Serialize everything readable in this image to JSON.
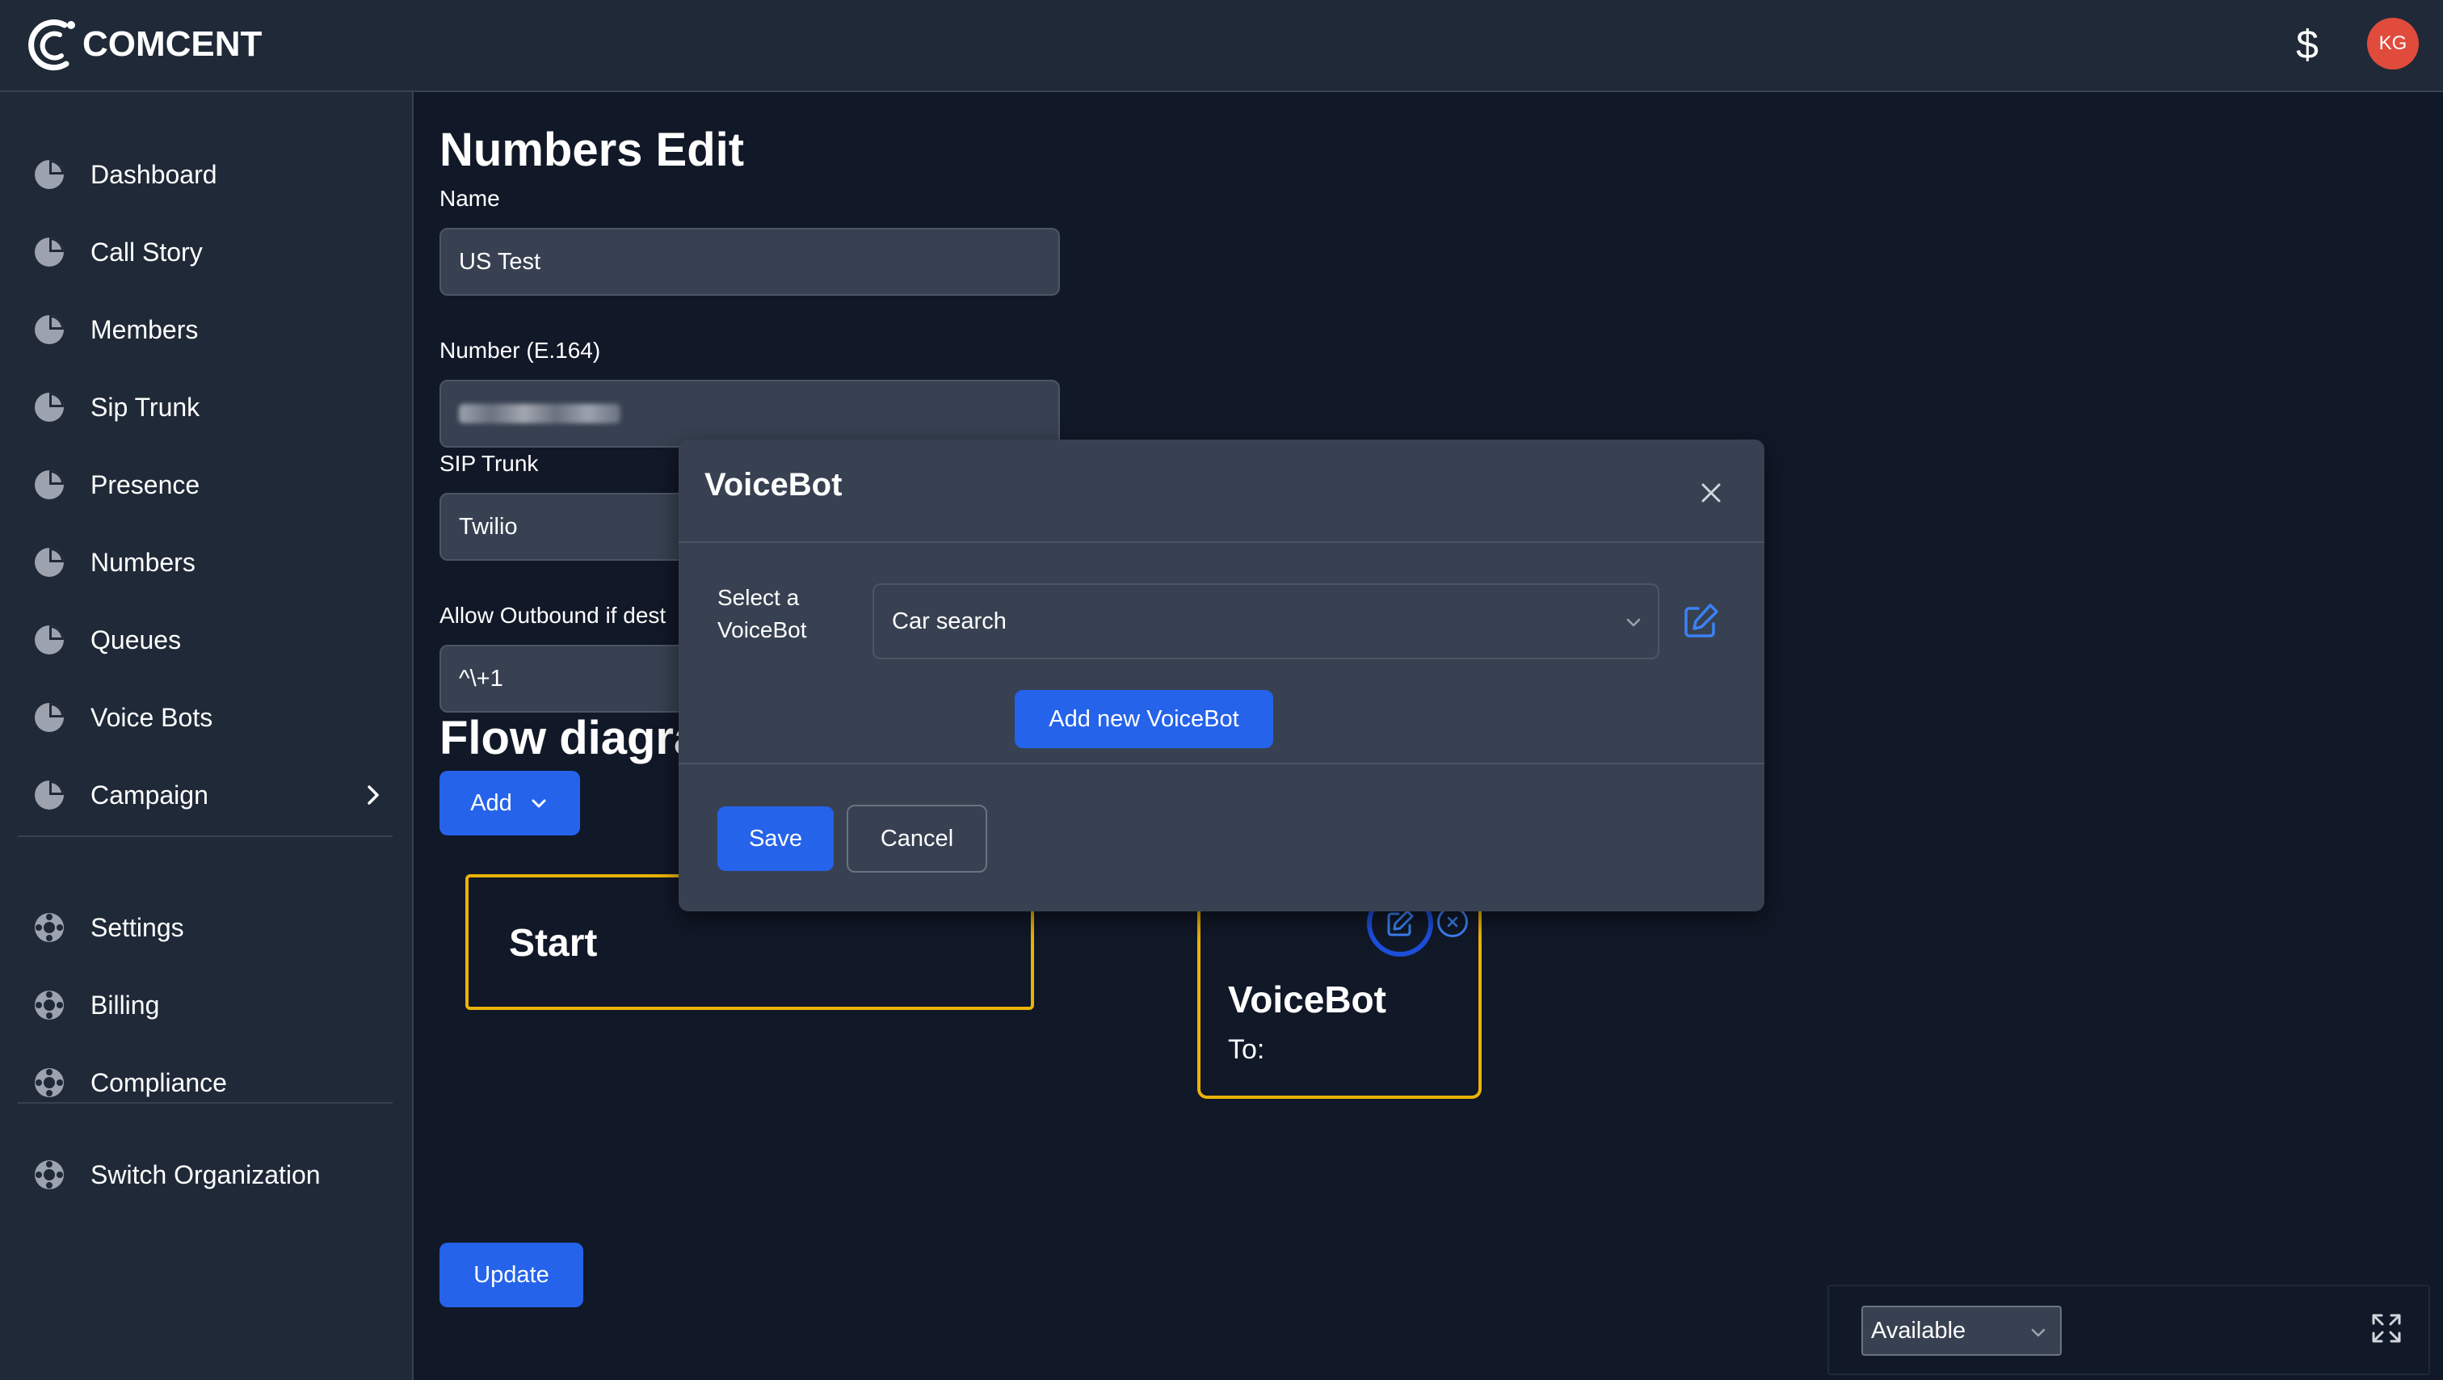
{
  "header": {
    "brand": "COMCENT",
    "dollar_symbol": "$",
    "avatar_initials": "KG",
    "avatar_color": "#e04b3c"
  },
  "sidebar": {
    "items": [
      {
        "label": "Dashboard",
        "icon": "pie-chart-icon"
      },
      {
        "label": "Call Story",
        "icon": "pie-chart-icon"
      },
      {
        "label": "Members",
        "icon": "pie-chart-icon"
      },
      {
        "label": "Sip Trunk",
        "icon": "pie-chart-icon"
      },
      {
        "label": "Presence",
        "icon": "pie-chart-icon"
      },
      {
        "label": "Numbers",
        "icon": "pie-chart-icon"
      },
      {
        "label": "Queues",
        "icon": "pie-chart-icon"
      },
      {
        "label": "Voice Bots",
        "icon": "pie-chart-icon"
      },
      {
        "label": "Campaign",
        "icon": "pie-chart-icon"
      }
    ],
    "secondary_items": [
      {
        "label": "Settings",
        "icon": "lifebuoy-icon"
      },
      {
        "label": "Billing",
        "icon": "lifebuoy-icon"
      },
      {
        "label": "Compliance",
        "icon": "lifebuoy-icon"
      }
    ],
    "footer_items": [
      {
        "label": "Switch Organization",
        "icon": "lifebuoy-icon"
      }
    ]
  },
  "form": {
    "title": "Numbers Edit",
    "name_label": "Name",
    "name_value": "US Test",
    "number_label": "Number (E.164)",
    "sip_label": "SIP Trunk",
    "sip_value": "Twilio",
    "outbound_label": "Allow Outbound if dest",
    "outbound_value": "^\\+1",
    "flow_title": "Flow diagra",
    "add_label": "Add",
    "update_label": "Update"
  },
  "flow": {
    "start_label": "Start",
    "voicebot_title": "VoiceBot",
    "voicebot_to": "To:"
  },
  "modal": {
    "title": "VoiceBot",
    "select_label": "Select a VoiceBot",
    "select_value": "Car search",
    "add_new_label": "Add new VoiceBot",
    "save_label": "Save",
    "cancel_label": "Cancel"
  },
  "status": {
    "value": "Available"
  },
  "colors": {
    "primary": "#2563eb",
    "node_border": "#eab308",
    "panel": "#1f2937",
    "background": "#111827"
  }
}
